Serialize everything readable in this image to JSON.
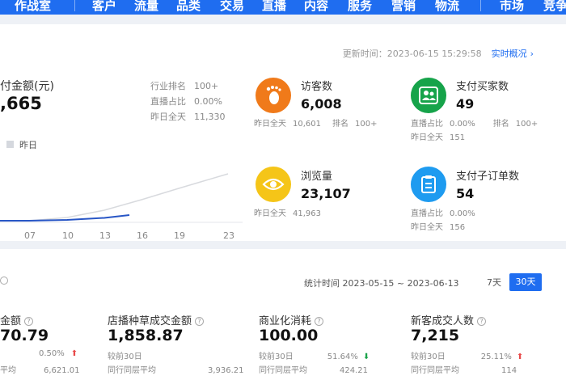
{
  "nav": {
    "items": [
      "作战室",
      "客户",
      "流量",
      "品类",
      "交易",
      "直播",
      "内容",
      "服务",
      "营销",
      "物流",
      "市场",
      "竞争"
    ],
    "color": "#1f6df0"
  },
  "header": {
    "update_label": "更新时间：2023-06-15 15:29:58",
    "realtime_link": "实时概况",
    "chevron": "›"
  },
  "pay": {
    "title": "付金额(元)",
    "value": ",665",
    "legend": "昨日",
    "rank_label": "行业排名",
    "rank_value": "100+",
    "live_ratio_label": "直播占比",
    "live_ratio_value": "0.00%",
    "yesterday_label": "昨日全天",
    "yesterday_value": "11,330"
  },
  "chart_data": {
    "type": "line",
    "x_ticks": [
      "07",
      "10",
      "13",
      "16",
      "19",
      "23"
    ],
    "series": [
      {
        "color": "#2856c6",
        "values": [
          0,
          0.1,
          0.35,
          0.7,
          1.3,
          2.1
        ]
      },
      {
        "color": "#d8dade",
        "values": [
          0,
          0.4,
          1.3,
          2.6,
          4.0,
          5.8
        ]
      }
    ]
  },
  "metrics": {
    "visitors": {
      "title": "访客数",
      "value": "6,008",
      "sub1_label": "昨日全天",
      "sub1_value": "10,601",
      "sub2_label": "排名",
      "sub2_value": "100+",
      "icon": "footprint-icon",
      "color": "#f07a1a"
    },
    "buyers": {
      "title": "支付买家数",
      "value": "49",
      "sub1_label": "直播占比",
      "sub1_value": "0.00%",
      "sub2_label": "排名",
      "sub2_value": "100+",
      "sub3_label": "昨日全天",
      "sub3_value": "151",
      "icon": "users-icon",
      "color": "#16a34a"
    },
    "views": {
      "title": "浏览量",
      "value": "23,107",
      "sub1_label": "昨日全天",
      "sub1_value": "41,963",
      "icon": "eye-icon",
      "color": "#f5c518"
    },
    "orders": {
      "title": "支付子订单数",
      "value": "54",
      "sub1_label": "直播占比",
      "sub1_value": "0.00%",
      "sub2_label": "昨日全天",
      "sub2_value": "156",
      "icon": "clipboard-icon",
      "color": "#1e9bf0"
    }
  },
  "period": {
    "label": "统计时间 2023-05-15 ~ 2023-06-13",
    "btn_7": "7天",
    "btn_30": "30天"
  },
  "bottom": [
    {
      "title": "金额",
      "value": "70.79",
      "cmp_label": "",
      "cmp_value": "0.50%",
      "dir": "up",
      "avg_label": "平均",
      "avg_value": "6,621.01"
    },
    {
      "title": "店播种草成交金额",
      "value": "1,858.87",
      "cmp_label": "较前30日",
      "cmp_value": "",
      "dir": "",
      "avg_label": "同行同层平均",
      "avg_value": "3,936.21"
    },
    {
      "title": "商业化消耗",
      "value": "100.00",
      "cmp_label": "较前30日",
      "cmp_value": "51.64%",
      "dir": "down",
      "avg_label": "同行同层平均",
      "avg_value": "424.21"
    },
    {
      "title": "新客成交人数",
      "value": "7,215",
      "cmp_label": "较前30日",
      "cmp_value": "25.11%",
      "dir": "up",
      "avg_label": "同行同层平均",
      "avg_value": "114"
    }
  ]
}
